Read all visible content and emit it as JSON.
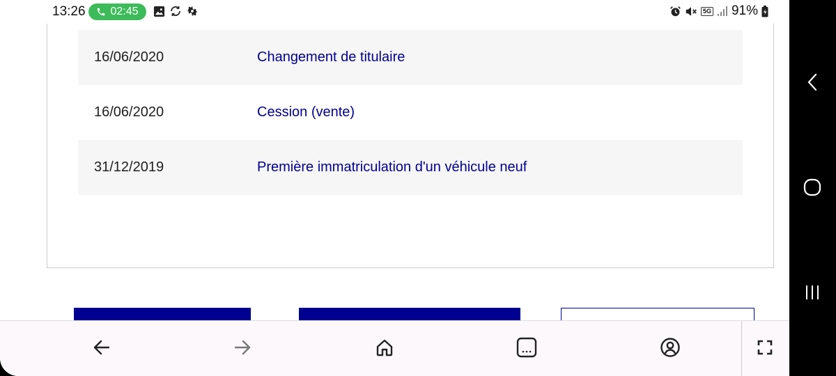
{
  "status_bar": {
    "time": "13:26",
    "call_timer": "02:45",
    "badge_5g": "5G",
    "battery": "91%"
  },
  "history": {
    "rows": [
      {
        "date": "16/06/2020",
        "event": "Changement de titulaire"
      },
      {
        "date": "16/06/2020",
        "event": "Cession (vente)"
      },
      {
        "date": "31/12/2019",
        "event": "Première immatriculation d'un véhicule neuf"
      }
    ]
  },
  "toolbar": {
    "back_icon": "arrow-left-icon",
    "forward_icon": "arrow-right-icon",
    "home_icon": "home-icon",
    "tabs_icon": "tabs-icon",
    "profile_icon": "profile-icon",
    "fullscreen_icon": "fullscreen-icon"
  },
  "nav_bar": {
    "back": "back-chevron-icon",
    "home": "home-circle-icon",
    "recents": "recents-icon"
  },
  "colors": {
    "accent": "#000091",
    "call_green": "#3dbb5a",
    "row_shade": "#f6f6f6"
  }
}
